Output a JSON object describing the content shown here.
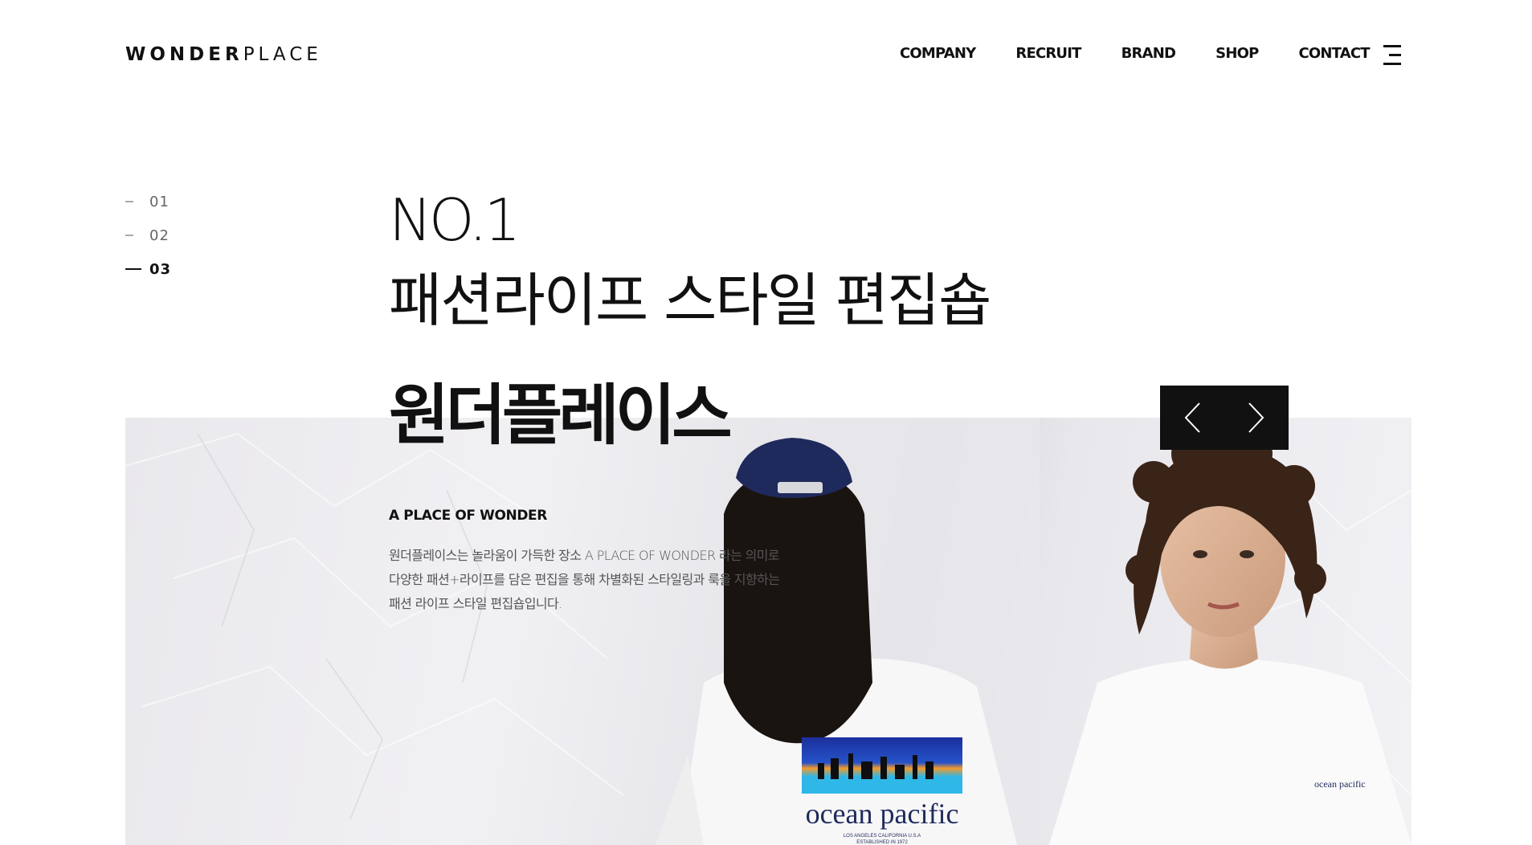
{
  "header": {
    "logo_bold": "WONDER",
    "logo_light": "PLACE",
    "nav": [
      "COMPANY",
      "RECRUIT",
      "BRAND",
      "SHOP",
      "CONTACT"
    ]
  },
  "pager": {
    "items": [
      "01",
      "02",
      "03"
    ],
    "active_index": 2
  },
  "hero": {
    "headline_line1": "NO.1",
    "headline_line2": "패션라이프 스타일 편집숍",
    "brand_title": "원더플레이스",
    "eyebrow": "A PLACE OF WONDER",
    "description": "원더플레이스는 놀라움이 가득한 장소 A PLACE OF WONDER 라는 의미로 다양한 패션+라이프를 담은 편집을 통해 차별화된 스타일링과 룩을 지향하는 패션 라이프 스타일 편집숍입니다.",
    "tee_print": "ocean pacific",
    "tee_small": "ocean pacific",
    "tee_fine": "LOS ANGELES CALIFORNIA U.S.A",
    "tee_fine2": "ESTABLISHED IN 1972"
  },
  "colors": {
    "text": "#111111",
    "muted": "#555555",
    "arrow_bg": "#111111",
    "cap": "#1f2a5c"
  },
  "icons": {
    "menu": "hamburger-icon",
    "prev": "chevron-left-icon",
    "next": "chevron-right-icon"
  }
}
